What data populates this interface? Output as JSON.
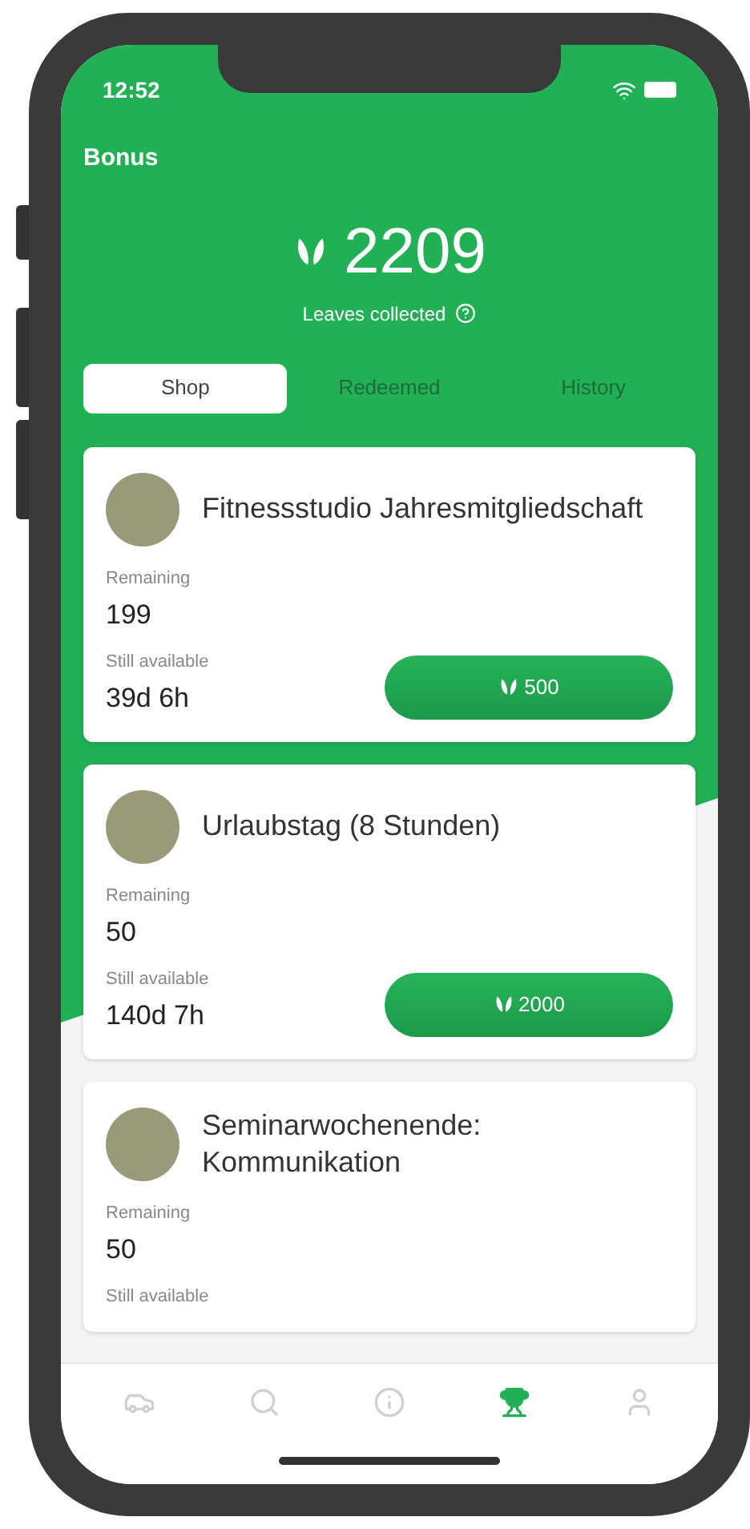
{
  "status_bar": {
    "time": "12:52"
  },
  "header": {
    "title": "Bonus",
    "balance": "2209",
    "balance_label": "Leaves collected"
  },
  "tabs": [
    {
      "label": "Shop",
      "selected": true
    },
    {
      "label": "Redeemed",
      "selected": false
    },
    {
      "label": "History",
      "selected": false
    }
  ],
  "rewards": [
    {
      "title": "Fitnessstudio Jahresmitgliedschaft",
      "remaining_label": "Remaining",
      "remaining": "199",
      "available_label": "Still available",
      "available": "39d 6h",
      "price": "500"
    },
    {
      "title": "Urlaubstag (8 Stunden)",
      "remaining_label": "Remaining",
      "remaining": "50",
      "available_label": "Still available",
      "available": "140d 7h",
      "price": "2000"
    },
    {
      "title": "Seminarwochenende: Kommunikation",
      "remaining_label": "Remaining",
      "remaining": "50",
      "available_label": "Still available"
    }
  ],
  "nav": [
    {
      "kind": "car",
      "selected": false
    },
    {
      "kind": "search",
      "selected": false
    },
    {
      "kind": "info",
      "selected": false
    },
    {
      "kind": "trophy",
      "selected": true
    },
    {
      "kind": "user",
      "selected": false
    }
  ]
}
